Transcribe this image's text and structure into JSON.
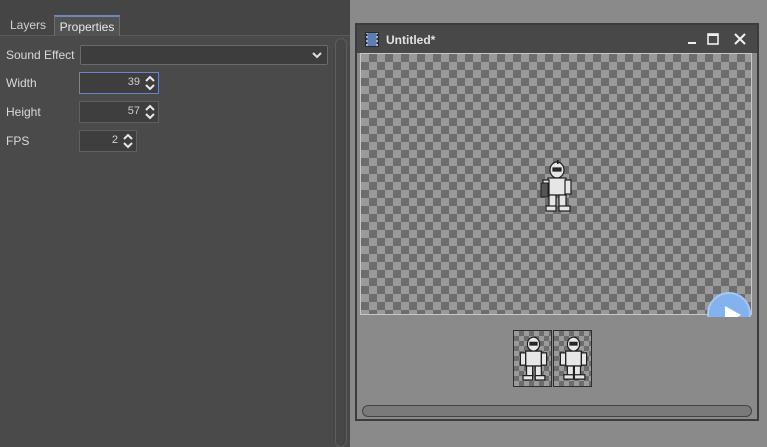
{
  "tabs": {
    "layers": "Layers",
    "properties": "Properties"
  },
  "properties": {
    "sound_effect": {
      "label": "Sound Effect",
      "value": ""
    },
    "width": {
      "label": "Width",
      "value": "39"
    },
    "height": {
      "label": "Height",
      "value": "57"
    },
    "fps": {
      "label": "FPS",
      "value": "2"
    }
  },
  "preview_window": {
    "title": "Untitled*",
    "icon": "film-icon",
    "controls": [
      "minimize-icon",
      "maximize-icon",
      "close-icon"
    ],
    "frame_count": 2
  },
  "colors": {
    "accent": "#6b84c4",
    "play_button": "#84b2ee",
    "panel_bg": "#4a4a4a",
    "canvas_bg": "#8a8a8a"
  }
}
